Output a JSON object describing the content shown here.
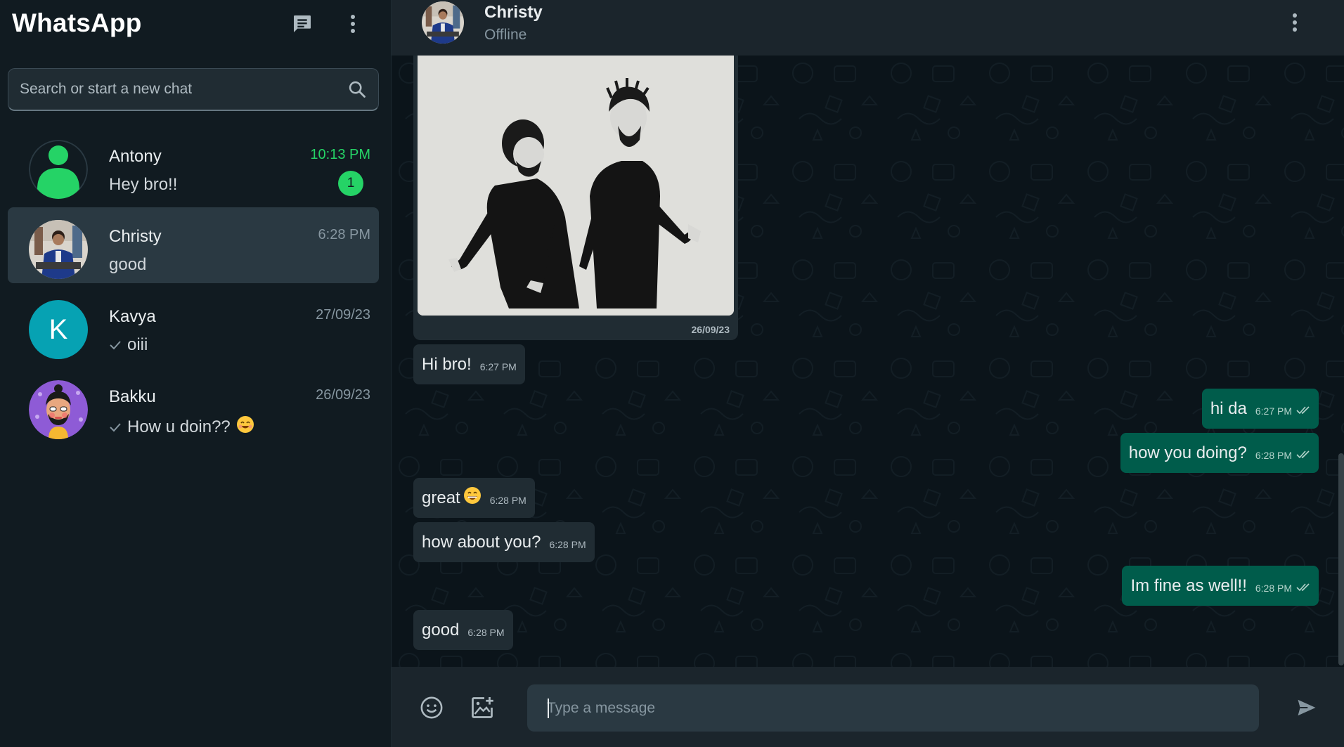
{
  "app": {
    "title": "WhatsApp"
  },
  "search": {
    "placeholder": "Search or start a new chat"
  },
  "chats": [
    {
      "name": "Antony",
      "preview": "Hey bro!!",
      "time": "10:13 PM",
      "unread": "1",
      "active": false
    },
    {
      "name": "Christy",
      "preview": "good",
      "time": "6:28 PM",
      "active": true
    },
    {
      "name": "Kavya",
      "preview": "oiii",
      "time": "27/09/23",
      "sent_tick": true,
      "avatar_letter": "K"
    },
    {
      "name": "Bakku",
      "preview": "How u doin??",
      "time": "26/09/23",
      "sent_tick": true,
      "emoji": "smiling-face-icon"
    }
  ],
  "conversation": {
    "contact_name": "Christy",
    "status": "Offline",
    "image_message": {
      "date": "26/09/23"
    },
    "messages": [
      {
        "dir": "in",
        "text": "Hi bro!",
        "time": "6:27 PM"
      },
      {
        "dir": "out",
        "text": "hi da",
        "time": "6:27 PM"
      },
      {
        "dir": "out",
        "text": "how you doing?",
        "time": "6:28 PM"
      },
      {
        "dir": "in",
        "text": "great",
        "time": "6:28 PM",
        "emoji": "grinning-face-icon"
      },
      {
        "dir": "in",
        "text": "how about you?",
        "time": "6:28 PM"
      },
      {
        "dir": "out",
        "text": "Im fine as well!!",
        "time": "6:28 PM"
      },
      {
        "dir": "in",
        "text": "good",
        "time": "6:28 PM"
      }
    ]
  },
  "composer": {
    "placeholder": "Type a message"
  },
  "colors": {
    "accent": "#25d366",
    "outgoing_bubble": "#005c4b",
    "incoming_bubble": "#202c33",
    "sidebar_bg": "#111b21",
    "header_bg": "#1b252c"
  }
}
